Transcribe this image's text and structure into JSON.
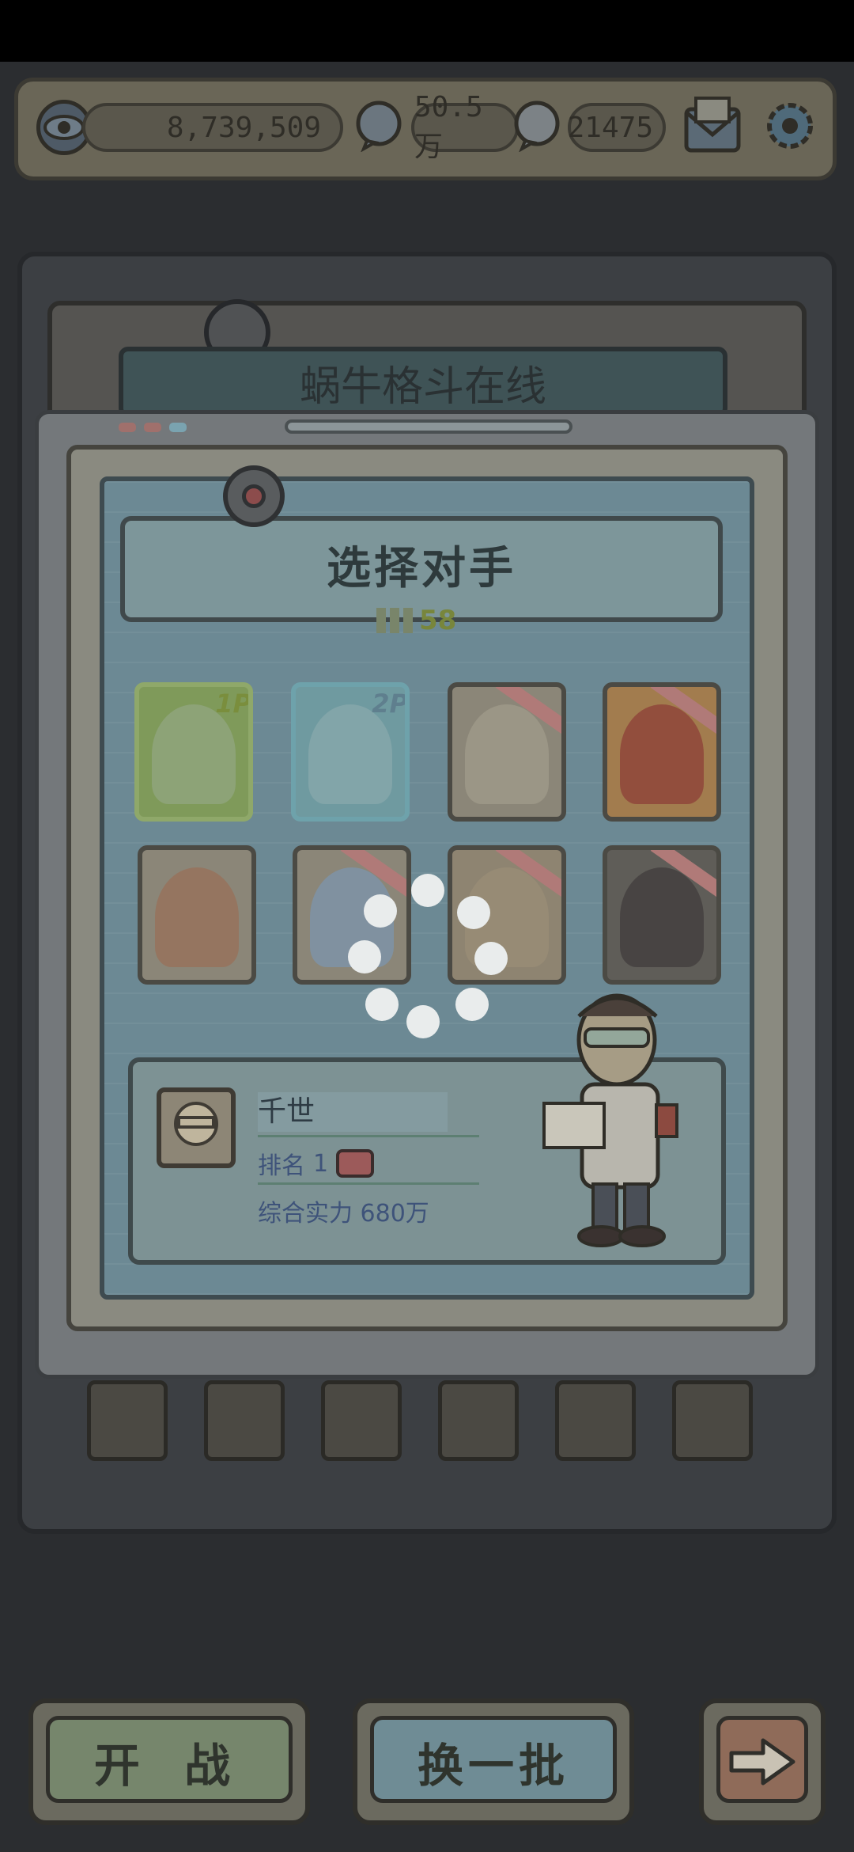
{
  "stats": {
    "views": "8,739,509",
    "coins": "50.5万",
    "gems": "21475"
  },
  "background": {
    "title": "蜗牛格斗在线"
  },
  "dialog": {
    "title": "选择对手",
    "level": "58",
    "cards": [
      {
        "tag": "1P"
      },
      {
        "tag": "2P"
      },
      {
        "tag": ""
      },
      {
        "tag": ""
      },
      {
        "tag": ""
      },
      {
        "tag": ""
      },
      {
        "tag": ""
      },
      {
        "tag": ""
      }
    ],
    "opponent": {
      "name": "千世",
      "rank_label": "排名",
      "rank_value": "1",
      "power_label": "综合实力",
      "power_value": "680万"
    }
  },
  "buttons": {
    "start": "开 战",
    "refresh": "换一批"
  },
  "colors": {
    "overlay": "#2b2d30",
    "board": "#6c8994",
    "card_1p": "#7f9a5a",
    "card_2p": "#6f9aa0",
    "start_button": "#76866c",
    "refresh_button": "#6f8c95",
    "next_button": "#8f6b59"
  }
}
